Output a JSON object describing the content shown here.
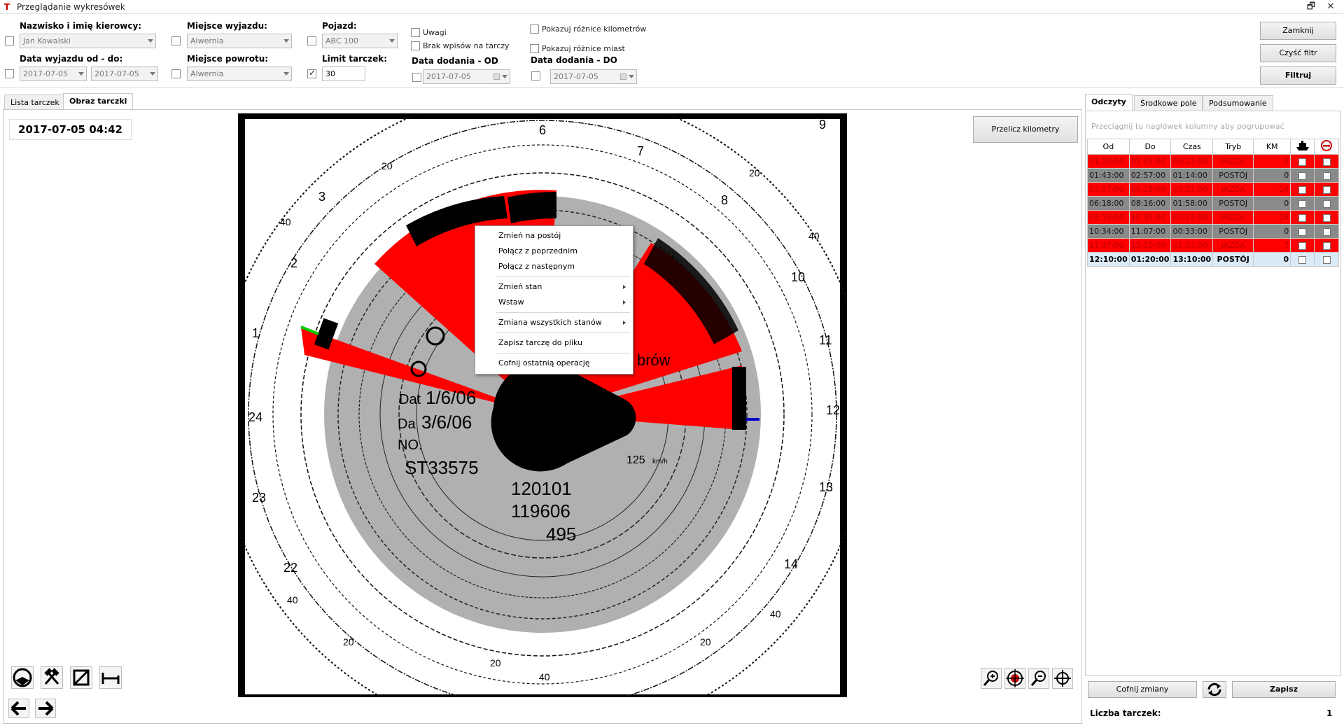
{
  "window": {
    "title": "Przeglądanie wykresówek",
    "app_icon": "T",
    "restore_glyph": "🗗",
    "close_glyph": "✕"
  },
  "filters": {
    "driver_label": "Nazwisko i imię kierowcy:",
    "driver_value": "Jan Kowalski",
    "departure_place_label": "Miejsce wyjazdu:",
    "departure_place_value": "Alwernia",
    "vehicle_label": "Pojazd:",
    "vehicle_value": "ABC 100",
    "remarks_label": "Uwagi",
    "no_entries_label": "Brak wpisów na tarczy",
    "km_diff_label": "Pokazuj różnice kilometrów",
    "place_diff_label": "Pokazuj różnice miast",
    "date_range_label": "Data wyjazdu od - do:",
    "date_from": "2017-07-05",
    "date_to": "2017-07-05",
    "return_place_label": "Miejsce powrotu:",
    "return_place_value": "Alwernia",
    "limit_label": "Limit tarczek:",
    "limit_value": "30",
    "added_from_label": "Data dodania - OD",
    "added_from_value": "2017-07-05",
    "added_to_label": "Data dodania - DO",
    "added_to_value": "2017-07-05"
  },
  "buttons": {
    "close": "Zamknij",
    "clear_filter": "Czyść filtr",
    "filter": "Filtruj",
    "recalc_km": "Przelicz kilometry",
    "undo_changes": "Cofnij zmiany",
    "save": "Zapisz"
  },
  "left_tabs": [
    "Lista tarczek",
    "Obraz tarczki"
  ],
  "disc_datetime": "2017-07-05 04:42",
  "disc_text": {
    "dat": "Dat",
    "dat_val": "1/6/06",
    "da": "Da",
    "da_val": "3/6/06",
    "no": "NO.",
    "reg": "ST33575",
    "odo1": "120101",
    "odo2": "119606",
    "dist": "495",
    "speed": "125",
    "speed_unit": "km/h",
    "place": "brów",
    "hours": [
      "6",
      "7",
      "8",
      "9",
      "10",
      "11",
      "12",
      "13",
      "14",
      "3",
      "2",
      "1",
      "24",
      "23",
      "22"
    ],
    "speeds": [
      "20",
      "40",
      "20",
      "40",
      "20",
      "40",
      "20",
      "40",
      "20",
      "40"
    ]
  },
  "context_menu": {
    "items": [
      "Zmień na postój",
      "Połącz z poprzednim",
      "Połącz z następnym",
      "Zmień stan",
      "Wstaw",
      "Zmiana wszystkich stanów",
      "Zapisz tarczę do pliku",
      "Cofnij ostatnią operację"
    ]
  },
  "right_tabs": [
    "Odczyty",
    "Środkowe pole",
    "Podsumowanie"
  ],
  "group_hint": "Przeciągnij tu nagłówek kolumny aby pogrupować",
  "table": {
    "headers": [
      "Od",
      "Do",
      "Czas",
      "Tryb",
      "KM"
    ],
    "rows": [
      {
        "od": "01:20:00",
        "do": "01:43:00",
        "czas": "00:23:00",
        "tryb": "JAZDA",
        "km": "2",
        "state": "red"
      },
      {
        "od": "01:43:00",
        "do": "02:57:00",
        "czas": "01:14:00",
        "tryb": "POSTÓJ",
        "km": "0",
        "state": "gray"
      },
      {
        "od": "02:57:00",
        "do": "06:18:00",
        "czas": "03:21:00",
        "tryb": "JAZDA",
        "km": "24",
        "state": "red"
      },
      {
        "od": "06:18:00",
        "do": "08:16:00",
        "czas": "01:58:00",
        "tryb": "POSTÓJ",
        "km": "0",
        "state": "gray"
      },
      {
        "od": "08:16:00",
        "do": "10:34:00",
        "czas": "02:18:00",
        "tryb": "JAZDA",
        "km": "16",
        "state": "red"
      },
      {
        "od": "10:34:00",
        "do": "11:07:00",
        "czas": "00:33:00",
        "tryb": "POSTÓJ",
        "km": "0",
        "state": "gray"
      },
      {
        "od": "11:07:00",
        "do": "12:10:00",
        "czas": "01:03:00",
        "tryb": "JAZDA",
        "km": "7",
        "state": "red"
      },
      {
        "od": "12:10:00",
        "do": "01:20:00",
        "czas": "13:10:00",
        "tryb": "POSTÓJ",
        "km": "0",
        "state": "sel"
      }
    ]
  },
  "count_label": "Liczba tarczek:",
  "count_value": "1",
  "colors": {
    "drive": "#ff0000",
    "stop": "#8a8a8a",
    "selected": "#dbeaf7"
  }
}
